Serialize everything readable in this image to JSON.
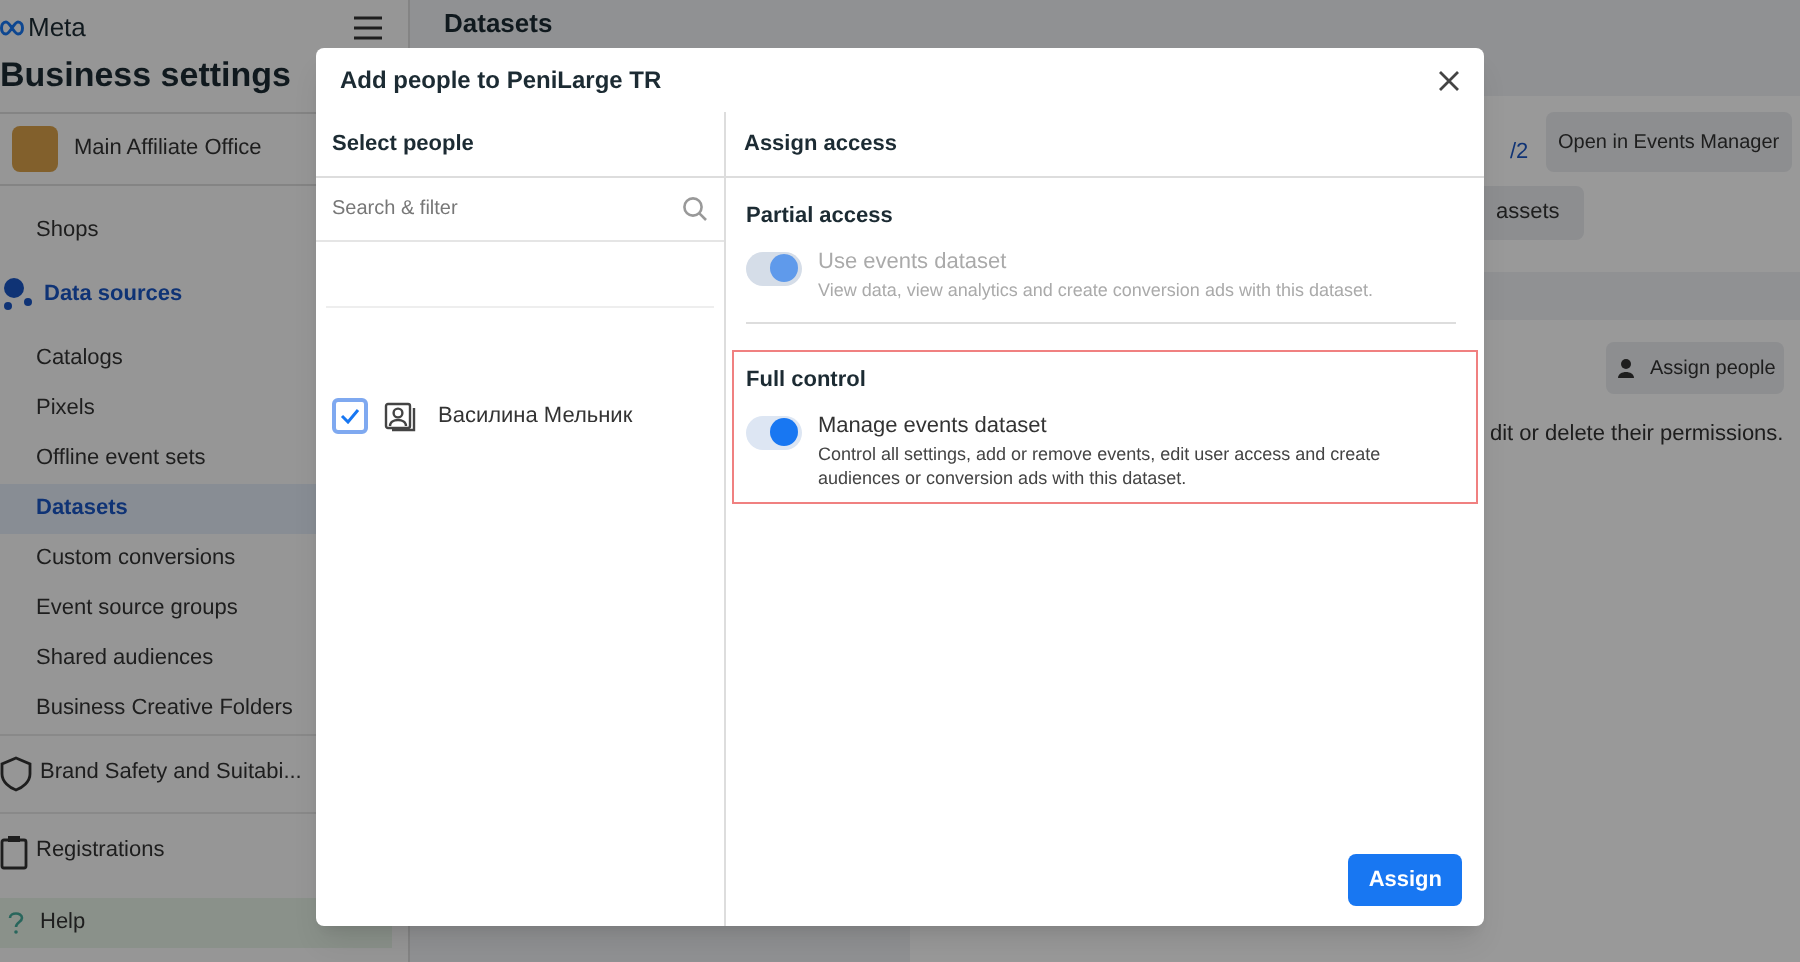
{
  "sidebar": {
    "logo": "Meta",
    "title": "Business settings",
    "account": "Main Affiliate Office",
    "items": [
      {
        "kind": "sub",
        "label": "Shops",
        "selected": false
      },
      {
        "kind": "section",
        "label": "Data sources",
        "selected": true
      },
      {
        "kind": "sub",
        "label": "Catalogs",
        "selected": false
      },
      {
        "kind": "sub",
        "label": "Pixels",
        "selected": false
      },
      {
        "kind": "sub",
        "label": "Offline event sets",
        "selected": false
      },
      {
        "kind": "sub",
        "label": "Datasets",
        "selected": true
      },
      {
        "kind": "sub",
        "label": "Custom conversions",
        "selected": false
      },
      {
        "kind": "sub",
        "label": "Event source groups",
        "selected": false
      },
      {
        "kind": "sub",
        "label": "Shared audiences",
        "selected": false
      },
      {
        "kind": "sub",
        "label": "Business Creative Folders",
        "selected": false
      },
      {
        "kind": "section",
        "label": "Brand Safety and Suitabi...",
        "selected": false
      },
      {
        "kind": "section",
        "label": "Registrations",
        "selected": false
      },
      {
        "kind": "help",
        "label": "Help",
        "selected": false
      }
    ]
  },
  "main": {
    "title": "Datasets",
    "link": "/2",
    "open_button": "Open in Events Manager",
    "assets_button": "assets",
    "assign_button": "Assign people",
    "description": "dit or delete their permissions."
  },
  "dialog": {
    "title": "Add people to PeniLarge TR",
    "left": {
      "header": "Select people",
      "search": {
        "placeholder": "Search & filter"
      },
      "people": [
        {
          "name": "Василина Мельник",
          "checked": true
        }
      ]
    },
    "right": {
      "header": "Assign access",
      "sections": [
        {
          "heading": "Partial access",
          "highlighted": false,
          "option": {
            "label": "Use events dataset",
            "description": "View data, view analytics and create conversion ads with this dataset.",
            "on": true,
            "disabled": true
          }
        },
        {
          "heading": "Full control",
          "highlighted": true,
          "option": {
            "label": "Manage events dataset",
            "description": "Control all settings, add or remove events, edit user access and create audiences or conversion ads with this dataset.",
            "on": true,
            "disabled": false
          }
        }
      ]
    },
    "assign": "Assign"
  }
}
